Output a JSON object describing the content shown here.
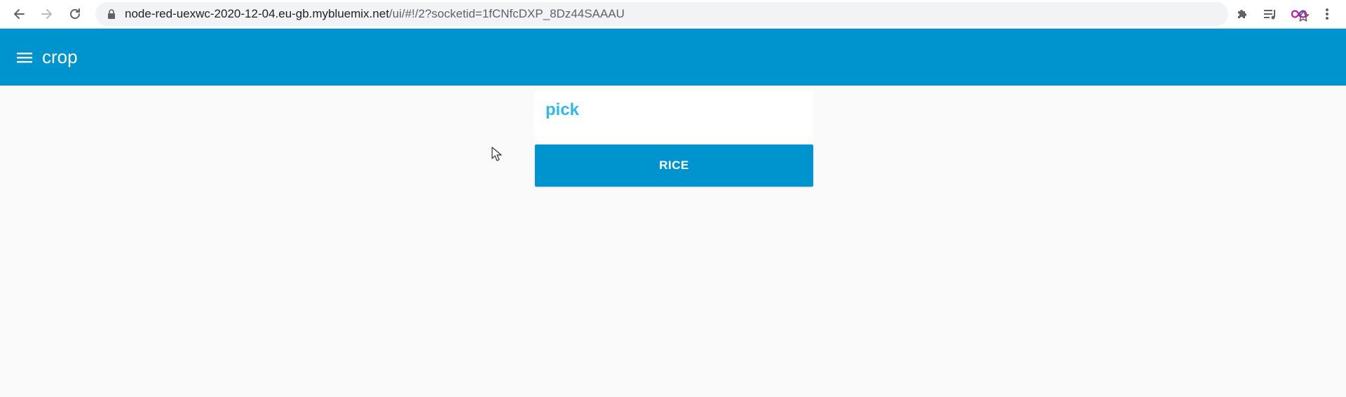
{
  "browser": {
    "url_host": "node-red-uexwc-2020-12-04.eu-gb.mybluemix.net",
    "url_path": "/ui/#!/2?socketid=1fCNfcDXP_8Dz44SAAAU",
    "icons": {
      "back": "back-arrow-icon",
      "forward": "forward-arrow-icon",
      "reload": "reload-icon",
      "lock": "lock-icon",
      "bookmark": "star-icon",
      "extensions": "puzzle-icon",
      "media": "media-queue-icon",
      "profile": "infinity-icon",
      "menu": "kebab-menu-icon"
    }
  },
  "app": {
    "title": "crop",
    "toolbar_color": "#0094ce",
    "menu_icon": "hamburger-menu-icon"
  },
  "group": {
    "title": "pick",
    "title_color": "#2db8ee",
    "button_label": "RICE",
    "button_color": "#0094ce"
  }
}
